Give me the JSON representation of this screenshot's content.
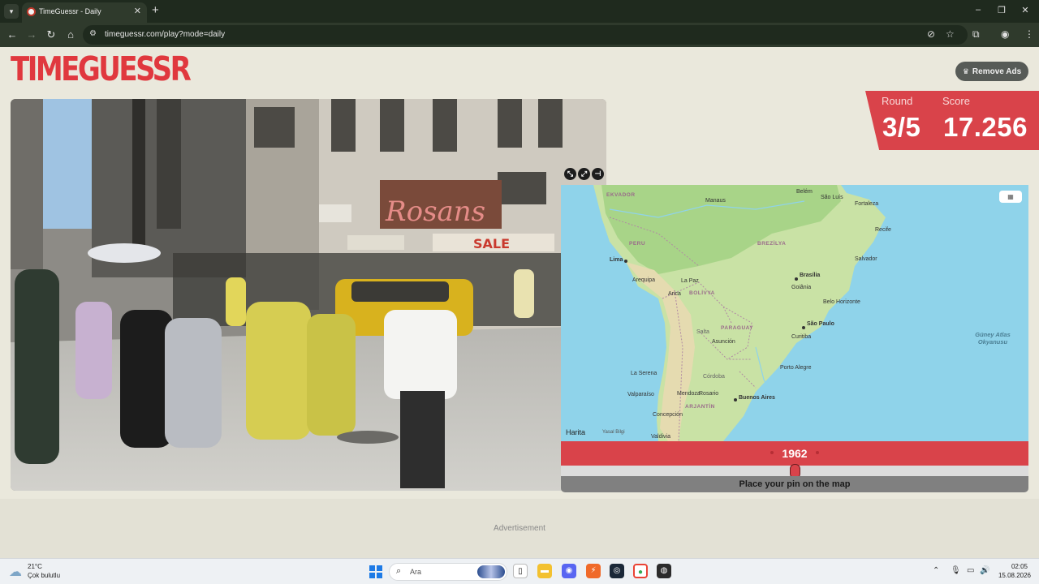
{
  "browser": {
    "tab_title": "TimeGuessr - Daily",
    "new_tab": "+",
    "url": "timeguessr.com/play?mode=daily"
  },
  "page": {
    "logo_text": "TIMEGUESSR",
    "remove_ads_label": "Remove Ads",
    "score_panel": {
      "round_label": "Round",
      "round_value": "3/5",
      "score_label": "Score",
      "score_value": "17.256"
    },
    "map": {
      "labels": {
        "ekvador": "EKVADOR",
        "manaus": "Manaus",
        "belem": "Belém",
        "sao_luis": "São Luís",
        "fortaleza": "Fortaleza",
        "recife": "Recife",
        "peru": "PERU",
        "brezilya": "BREZİLYA",
        "lima": "Lima",
        "salvador": "Salvador",
        "arequipa": "Arequipa",
        "la_paz": "La Paz",
        "brasilia": "Brasília",
        "goiania": "Goiânia",
        "arica": "Arica",
        "bolivya": "BOLİVYA",
        "belo_horizonte": "Belo Horizonte",
        "paraguay": "PARAGUAY",
        "sao_paulo": "São Paulo",
        "salta": "Salta",
        "curitiba": "Curitiba",
        "asuncion": "Asunción",
        "ocean": "Güney Atlas Okyanusu",
        "porto_alegre": "Porto Alegre",
        "la_serena": "La Serena",
        "cordoba": "Córdoba",
        "valparaiso": "Valparaíso",
        "mendoza": "Mendoza",
        "rosario": "Rosario",
        "buenos_aires": "Buenos Aires",
        "arjantin": "ARJANTİN",
        "concepcion": "Concepción",
        "valdivia": "Valdivia"
      },
      "attribution": "Harita",
      "legal": "Yasal Bilgi"
    },
    "year": "1962",
    "year_fraction": 0.5,
    "pin_instruction": "Place your pin on the map",
    "advertisement": "Advertisement"
  },
  "taskbar": {
    "weather_temp": "21°C",
    "weather_desc": "Çok bulutlu",
    "search_placeholder": "Ara",
    "time": "02:05",
    "date": "15.08.2026"
  },
  "colors": {
    "accent_red": "#d9434a",
    "page_bg": "#eae8dc",
    "chrome_dark": "#1f2a1e"
  }
}
